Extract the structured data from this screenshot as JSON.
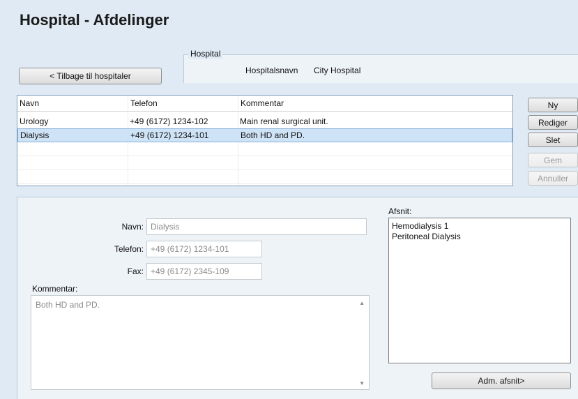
{
  "page": {
    "title": "Hospital - Afdelinger"
  },
  "back_button": {
    "label": "< Tilbage til hospitaler"
  },
  "hospital_group": {
    "legend": "Hospital",
    "name_label": "Hospitalsnavn",
    "name_value": "City Hospital"
  },
  "departments_table": {
    "columns": [
      "Navn",
      "Telefon",
      "Kommentar"
    ],
    "rows": [
      {
        "navn": "Urology",
        "telefon": "+49 (6172) 1234-102",
        "kommentar": "Main renal surgical unit.",
        "selected": false
      },
      {
        "navn": "Dialysis",
        "telefon": "+49 (6172) 1234-101",
        "kommentar": "Both HD and PD.",
        "selected": true
      }
    ]
  },
  "actions": {
    "new": "Ny",
    "edit": "Rediger",
    "delete": "Slet",
    "save": "Gem",
    "cancel": "Annuller"
  },
  "detail": {
    "navn_label": "Navn:",
    "navn_value": "Dialysis",
    "telefon_label": "Telefon:",
    "telefon_value": "+49 (6172) 1234-101",
    "fax_label": "Fax:",
    "fax_value": "+49 (6172) 2345-109",
    "kommentar_label": "Kommentar:",
    "kommentar_value": "Both HD and PD."
  },
  "afsnit": {
    "label": "Afsnit:",
    "items": [
      "Hemodialysis 1",
      "Peritoneal Dialysis"
    ],
    "manage_button": "Adm. afsnit>"
  }
}
